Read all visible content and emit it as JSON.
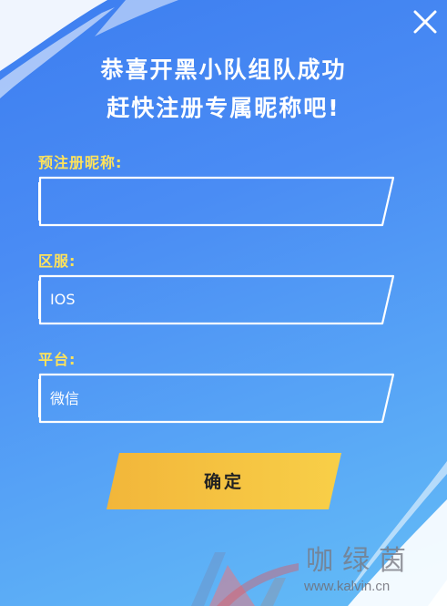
{
  "dialog": {
    "title_line1": "恭喜开黑小队组队成功",
    "title_line2": "赶快注册专属昵称吧!"
  },
  "form": {
    "nickname": {
      "label": "预注册昵称:",
      "value": "",
      "placeholder": ""
    },
    "server": {
      "label": "区服:",
      "value": "IOS"
    },
    "platform": {
      "label": "平台:",
      "value": "微信"
    }
  },
  "confirm_button": {
    "label": "确定"
  },
  "watermark": {
    "name": "咖绿茵",
    "url": "www.kalvin.cn"
  },
  "icons": {
    "close": "close-icon",
    "watermark_logo": "kalvin-logo-icon"
  },
  "colors": {
    "background_top": "#3d7ef0",
    "background_bottom": "#64bdf6",
    "label": "#ffe35a",
    "button": "#f6c33e",
    "text": "#ffffff"
  }
}
